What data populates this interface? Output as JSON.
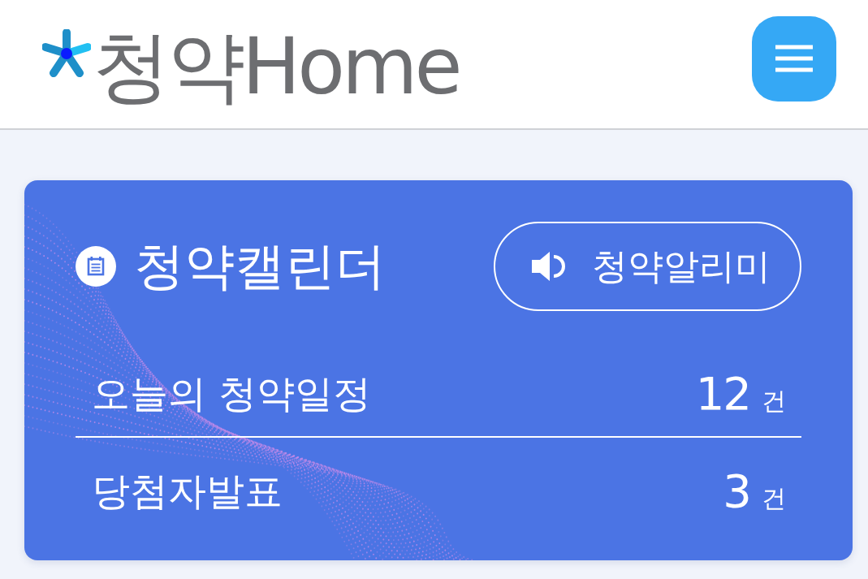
{
  "header": {
    "logo": "청약Home"
  },
  "calendar_card": {
    "title": "청약캘린더",
    "alert_button": {
      "label": "청약알리미"
    },
    "rows": [
      {
        "label": "오늘의 청약일정",
        "count": "12",
        "unit": "건"
      },
      {
        "label": "당첨자발표",
        "count": "3",
        "unit": "건"
      }
    ]
  }
}
